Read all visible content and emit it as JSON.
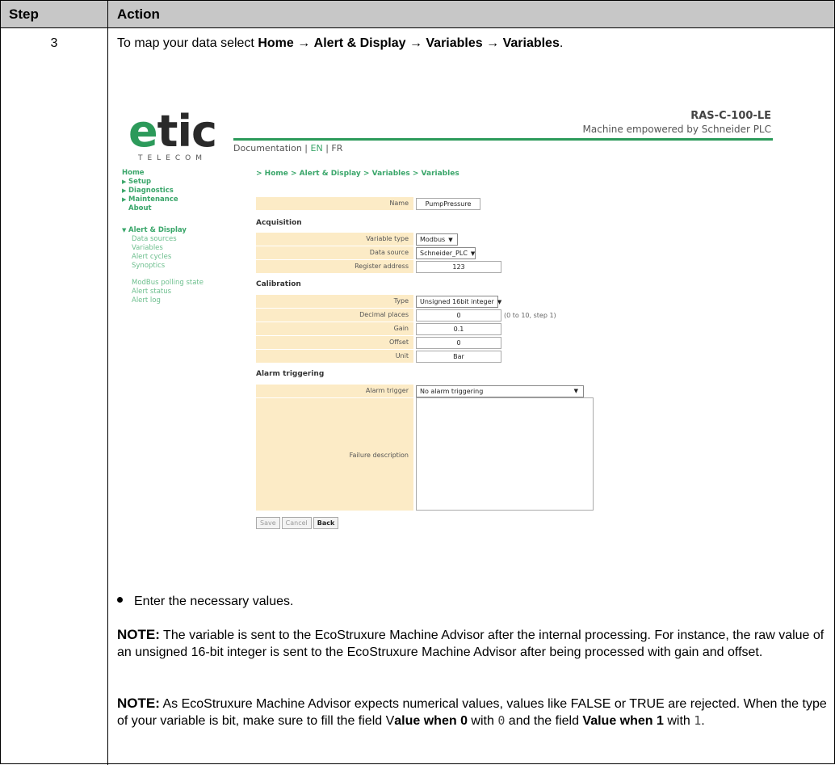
{
  "table": {
    "header_step": "Step",
    "header_action": "Action",
    "step_number": "3"
  },
  "intro": {
    "prefix": "To map your data select ",
    "path": [
      "Home",
      "Alert & Display",
      "Variables",
      "Variables"
    ],
    "arrow": "→",
    "suffix": "."
  },
  "screenshot": {
    "logo_main": "etic",
    "logo_sub": "TELECOM",
    "model": "RAS-C-100-LE",
    "tagline": "Machine empowered by Schneider PLC",
    "doc_link": "Documentation",
    "lang_sep": " | ",
    "lang_en": "EN",
    "lang_fr": "FR",
    "breadcrumb": "> Home > Alert & Display > Variables > Variables",
    "nav": {
      "home": "Home",
      "setup": "Setup",
      "diagnostics": "Diagnostics",
      "maintenance": "Maintenance",
      "about": "About",
      "alert_display": "Alert & Display",
      "data_sources": "Data sources",
      "variables": "Variables",
      "alert_cycles": "Alert cycles",
      "synoptics": "Synoptics",
      "modbus_polling": "ModBus polling state",
      "alert_status": "Alert status",
      "alert_log": "Alert log"
    },
    "form": {
      "name_label": "Name",
      "name_value": "PumpPressure",
      "acquisition_title": "Acquisition",
      "variable_type_label": "Variable type",
      "variable_type_value": "Modbus",
      "data_source_label": "Data source",
      "data_source_value": "Schneider_PLC",
      "register_label": "Register address",
      "register_value": "123",
      "calibration_title": "Calibration",
      "type_label": "Type",
      "type_value": "Unsigned 16bit integer",
      "decimal_label": "Decimal places",
      "decimal_value": "0",
      "decimal_hint": "(0 to 10, step 1)",
      "gain_label": "Gain",
      "gain_value": "0.1",
      "offset_label": "Offset",
      "offset_value": "0",
      "unit_label": "Unit",
      "unit_value": "Bar",
      "alarm_title": "Alarm triggering",
      "alarm_trigger_label": "Alarm trigger",
      "alarm_trigger_value": "No alarm triggering",
      "failure_label": "Failure description",
      "save": "Save",
      "cancel": "Cancel",
      "back": "Back"
    }
  },
  "bullet": "Enter the necessary values.",
  "note1": {
    "label": "NOTE:",
    "text": " The variable is sent to the EcoStruxure Machine Advisor after the internal processing. For instance, the raw value of an unsigned 16-bit integer is sent to the EcoStruxure Machine Advisor after being processed with gain and offset."
  },
  "note2": {
    "label": "NOTE:",
    "text_a": " As EcoStruxure Machine Advisor expects numerical values, values like FALSE or TRUE are rejected. When the type of your variable is bit, make sure to fill the field V",
    "bold_a": "alue when 0",
    "text_b": " with ",
    "code_a": "0",
    "text_c": " and the field ",
    "bold_b": "Value when 1",
    "text_d": " with ",
    "code_b": "1",
    "text_e": "."
  }
}
